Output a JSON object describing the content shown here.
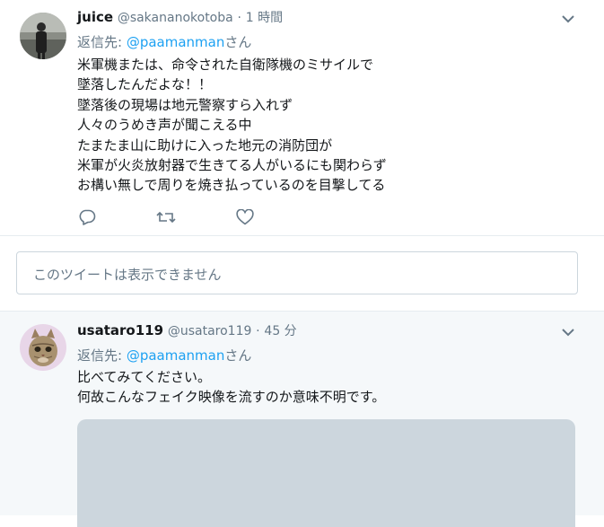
{
  "tweet1": {
    "display_name": "juice",
    "handle": "@sakananokotoba",
    "separator": "·",
    "time": "1 時間",
    "reply_prefix": "返信先: ",
    "reply_mention": "@paamanman",
    "reply_suffix": "さん",
    "lines": [
      "米軍機または、命令された自衛隊機のミサイルで",
      "墜落したんだよな！！",
      "墜落後の現場は地元警察すら入れず",
      "人々のうめき声が聞こえる中",
      "たまたま山に助けに入った地元の消防団が",
      "米軍が火炎放射器で生きてる人がいるにも関わらず",
      "お構い無しで周りを焼き払っているのを目撃してる"
    ],
    "actions": [
      "reply-icon",
      "retweet-icon",
      "like-icon"
    ]
  },
  "unavailable_notice": "このツイートは表示できません",
  "tweet2": {
    "display_name": "usataro119",
    "handle": "@usataro119",
    "separator": "·",
    "time": "45 分",
    "reply_prefix": "返信先: ",
    "reply_mention": "@paamanman",
    "reply_suffix": "さん",
    "lines": [
      "比べてみてください。",
      "何故こんなフェイク映像を流すのか意味不明です。"
    ]
  },
  "colors": {
    "link": "#1da1f2",
    "secondary_text": "#657786",
    "primary_text": "#14171a",
    "highlight_bg": "#f5f8fa",
    "media_placeholder": "#ccd6dd"
  }
}
